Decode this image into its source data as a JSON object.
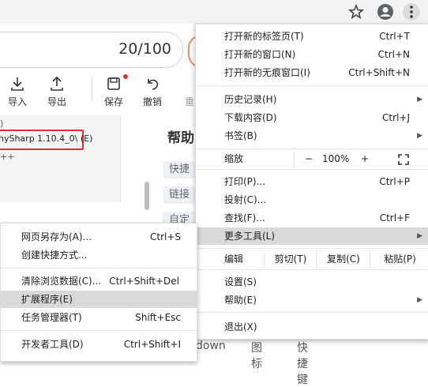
{
  "score": {
    "text": "20/100"
  },
  "toolbar": {
    "import": "导入",
    "export": "导出",
    "save": "保存",
    "undo": "撤销",
    "redo_partial": "重"
  },
  "tree": {
    "selected_item": "nySharp 1.10.4_0\\ (E)",
    "line1": ")",
    "line2": "++"
  },
  "help": {
    "title": "帮助",
    "chip1": "快捷",
    "chip2": "链接",
    "chip3": "自定"
  },
  "bottom_tabs": [
    "down",
    "图标",
    "快捷键"
  ],
  "menu": {
    "new_tab": {
      "label": "打开新的标签页(T)",
      "shortcut": "Ctrl+T"
    },
    "new_window": {
      "label": "打开新的窗口(N)",
      "shortcut": "Ctrl+N"
    },
    "incognito": {
      "label": "打开新的无痕窗口(I)",
      "shortcut": "Ctrl+Shift+N"
    },
    "history": {
      "label": "历史记录(H)"
    },
    "downloads": {
      "label": "下载内容(D)",
      "shortcut": "Ctrl+J"
    },
    "bookmarks": {
      "label": "书签(B)"
    },
    "zoom": {
      "label": "缩放",
      "minus": "−",
      "value": "100%",
      "plus": "+"
    },
    "print": {
      "label": "打印(P)...",
      "shortcut": "Ctrl+P"
    },
    "cast": {
      "label": "投射(C)..."
    },
    "find": {
      "label": "查找(F)...",
      "shortcut": "Ctrl+F"
    },
    "more_tools": {
      "label": "更多工具(L)"
    },
    "edit": {
      "label": "编辑",
      "cut": "剪切(T)",
      "copy": "复制(C)",
      "paste": "粘贴(P)"
    },
    "settings": {
      "label": "设置(S)"
    },
    "help": {
      "label": "帮助(E)"
    },
    "exit": {
      "label": "退出(X)"
    }
  },
  "submenu": {
    "save_page": {
      "label": "网页另存为(A)...",
      "shortcut": "Ctrl+S"
    },
    "create_shortcut": {
      "label": "创建快捷方式..."
    },
    "clear_data": {
      "label": "清除浏览数据(C)...",
      "shortcut": "Ctrl+Shift+Del"
    },
    "extensions": {
      "label": "扩展程序(E)"
    },
    "task_manager": {
      "label": "任务管理器(T)",
      "shortcut": "Shift+Esc"
    },
    "dev_tools": {
      "label": "开发者工具(D)",
      "shortcut": "Ctrl+Shift+I"
    }
  },
  "colors": {
    "highlight": "#d9d9d9",
    "red_box": "#e0302b",
    "orange": "#f08a5d"
  }
}
